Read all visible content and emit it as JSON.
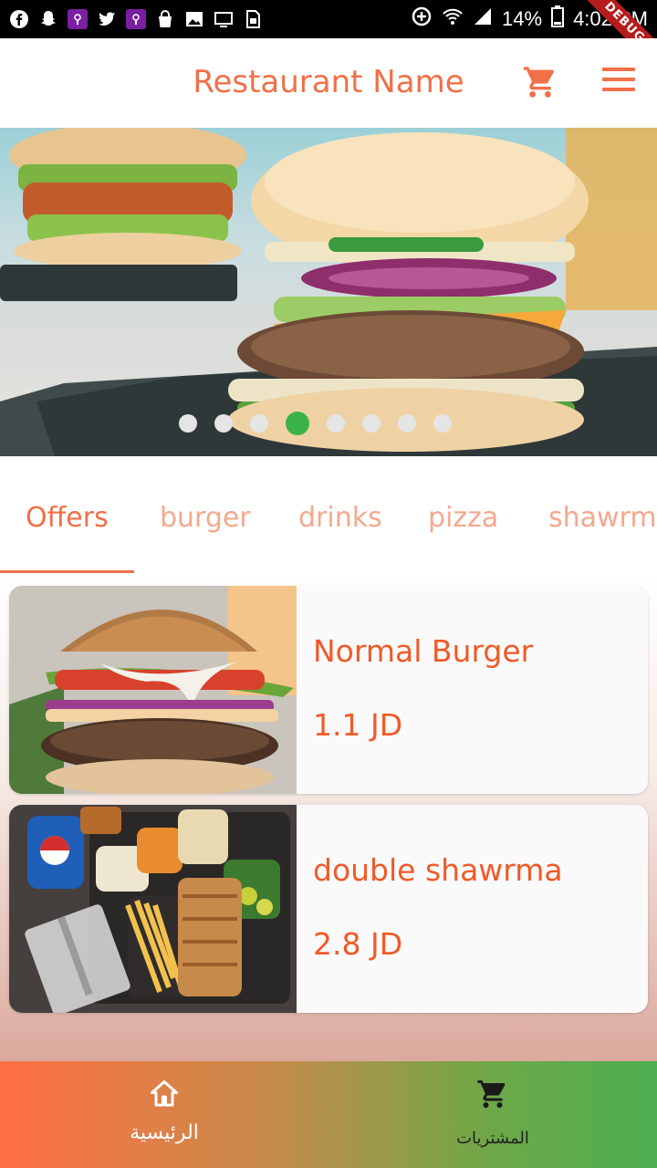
{
  "status_bar": {
    "battery": "14%",
    "time": "4:02 PM",
    "debug_label": "DEBUG",
    "left_icons": [
      "facebook-icon",
      "snapchat-icon",
      "podcast-icon",
      "twitter-icon",
      "podcast-icon",
      "shopping-bag-icon",
      "image-icon",
      "monitor-icon",
      "sim-icon"
    ],
    "right_icons": [
      "data-saver-icon",
      "wifi-icon",
      "signal-icon",
      "battery-icon"
    ]
  },
  "app_bar": {
    "title": "Restaurant Name",
    "cart_icon": "shopping-cart-icon",
    "menu_icon": "hamburger-menu-icon",
    "accent_color": "#f07048"
  },
  "carousel": {
    "image": "burger-photo",
    "dot_count": 8,
    "active_index": 3,
    "active_color": "#3db24a"
  },
  "tabs": [
    {
      "label": "Offers",
      "active": true
    },
    {
      "label": "burger",
      "active": false
    },
    {
      "label": "drinks",
      "active": false
    },
    {
      "label": "pizza",
      "active": false
    },
    {
      "label": "shawrma",
      "active": false
    }
  ],
  "items": [
    {
      "name": "Normal Burger",
      "price": "1.1 JD",
      "image": "burger-photo"
    },
    {
      "name": "double shawrma",
      "price": "2.8 JD",
      "image": "shawarma-meal-photo"
    }
  ],
  "bottom_nav": {
    "home": {
      "label": "الرئيسية",
      "icon": "home-icon"
    },
    "purchases": {
      "label": "المشتريات",
      "icon": "shopping-cart-icon"
    }
  }
}
